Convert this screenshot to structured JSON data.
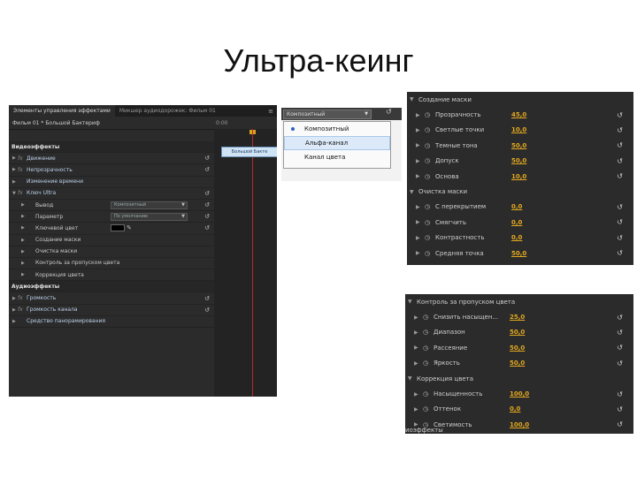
{
  "slide": {
    "title": "Ультра-кеинг"
  },
  "main_panel": {
    "tabs": [
      "Элементы управления эффектами",
      "Микшер аудиодорожек: Фильм 01"
    ],
    "panel_menu": "≡",
    "clip_name": "Фильм 01 * Большой Бактериф",
    "timecode": "0:00",
    "timeline_clip": "Большой Бакте",
    "rows": [
      {
        "kind": "section",
        "label": "Видеоэффекты"
      },
      {
        "kind": "effect",
        "fx": "fx",
        "label": "Движение",
        "reset": true
      },
      {
        "kind": "effect",
        "fx": "fx",
        "label": "Непрозрачность",
        "reset": true
      },
      {
        "kind": "effect",
        "fx": "",
        "label": "Изменение времени",
        "reset": false
      },
      {
        "kind": "effect",
        "fx": "fx",
        "label": "Ключ Ultra",
        "reset": true
      },
      {
        "kind": "prop",
        "label": "Вывод",
        "select": "Композитный",
        "reset": true
      },
      {
        "kind": "prop",
        "label": "Параметр",
        "select": "По умолчанию",
        "reset": true
      },
      {
        "kind": "color",
        "label": "Ключевой цвет",
        "reset": true
      },
      {
        "kind": "sub",
        "label": "Создание маски"
      },
      {
        "kind": "sub",
        "label": "Очистка маски"
      },
      {
        "kind": "sub",
        "label": "Контроль за пропуском цвета"
      },
      {
        "kind": "sub",
        "label": "Коррекция цвета"
      },
      {
        "kind": "section",
        "label": "Аудиоэффекты"
      },
      {
        "kind": "effect",
        "fx": "fx",
        "label": "Громкость",
        "reset": true
      },
      {
        "kind": "effect",
        "fx": "fx",
        "label": "Громкость канала",
        "reset": true
      },
      {
        "kind": "effect",
        "fx": "",
        "label": "Средство панорамирования",
        "reset": false
      }
    ]
  },
  "dropdown": {
    "current": "Композитный",
    "options": [
      {
        "label": "Композитный",
        "selected": true
      },
      {
        "label": "Альфа-канал",
        "hover": true
      },
      {
        "label": "Канал цвета"
      }
    ]
  },
  "mask_panel": {
    "groups": [
      {
        "label": "Создание маски",
        "items": [
          {
            "label": "Прозрачность",
            "value": "45,0"
          },
          {
            "label": "Светлые точки",
            "value": "10,0"
          },
          {
            "label": "Темные тона",
            "value": "50,0"
          },
          {
            "label": "Допуск",
            "value": "50,0"
          },
          {
            "label": "Основа",
            "value": "10,0"
          }
        ]
      },
      {
        "label": "Очистка маски",
        "items": [
          {
            "label": "С перекрытием",
            "value": "0,0"
          },
          {
            "label": "Смягчить",
            "value": "0,0"
          },
          {
            "label": "Контрастность",
            "value": "0,0"
          },
          {
            "label": "Средняя точка",
            "value": "50,0"
          }
        ]
      }
    ],
    "collapsed": [
      "Контроль за пропуском цвета",
      "Коррекция цвета"
    ]
  },
  "spill_panel": {
    "groups": [
      {
        "label": "Контроль за пропуском цвета",
        "items": [
          {
            "label": "Снизить насыщен...",
            "value": "25,0"
          },
          {
            "label": "Диапазон",
            "value": "50,0"
          },
          {
            "label": "Рассеяние",
            "value": "50,0"
          },
          {
            "label": "Яркость",
            "value": "50,0"
          }
        ]
      },
      {
        "label": "Коррекция цвета",
        "items": [
          {
            "label": "Насыщенность",
            "value": "100,0"
          },
          {
            "label": "Оттенок",
            "value": "0,0"
          },
          {
            "label": "Светимость",
            "value": "100,0"
          }
        ]
      }
    ],
    "footer": "иоэффекты"
  },
  "icons": {
    "reset": "↺",
    "twirl_open": "▼",
    "twirl_closed": "▶",
    "stopwatch": "◷",
    "eyedropper": "✎"
  },
  "colors": {
    "panel_bg": "#2b2b2b",
    "value_orange": "#e3a81f",
    "playline_red": "#c0262a",
    "selection_blue": "#dbe9f8"
  }
}
